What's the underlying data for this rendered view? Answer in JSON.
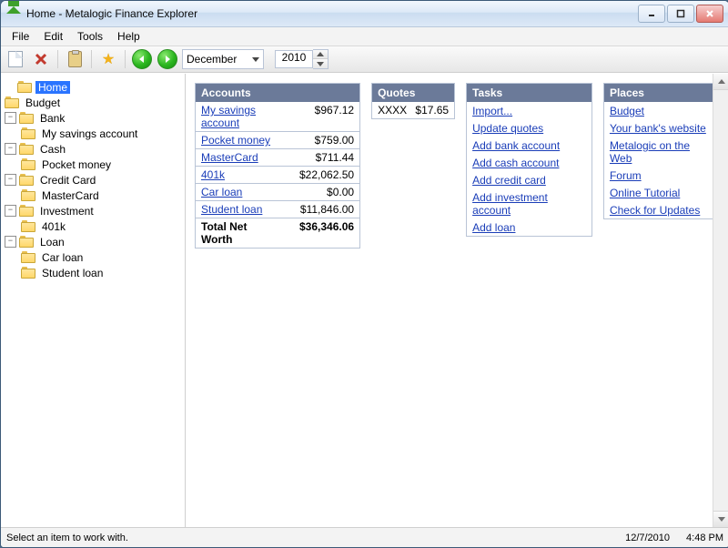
{
  "window": {
    "title": "Home - Metalogic Finance Explorer"
  },
  "menu": {
    "file": "File",
    "edit": "Edit",
    "tools": "Tools",
    "help": "Help"
  },
  "toolbar": {
    "month_selected": "December",
    "year_value": "2010"
  },
  "tree": {
    "home": "Home",
    "budget": "Budget",
    "bank": "Bank",
    "bank_items": {
      "savings": "My savings account"
    },
    "cash": "Cash",
    "cash_items": {
      "pocket": "Pocket money"
    },
    "credit": "Credit Card",
    "credit_items": {
      "mc": "MasterCard"
    },
    "investment": "Investment",
    "investment_items": {
      "k401": "401k"
    },
    "loan": "Loan",
    "loan_items": {
      "car": "Car loan",
      "student": "Student loan"
    }
  },
  "panels": {
    "accounts": {
      "title": "Accounts",
      "rows": [
        {
          "name": "My savings account",
          "value": "$967.12"
        },
        {
          "name": "Pocket money",
          "value": "$759.00"
        },
        {
          "name": "MasterCard",
          "value": "$711.44"
        },
        {
          "name": "401k",
          "value": "$22,062.50"
        },
        {
          "name": "Car loan",
          "value": "$0.00"
        },
        {
          "name": "Student loan",
          "value": "$11,846.00"
        }
      ],
      "total_label": "Total Net Worth",
      "total_value": "$36,346.06"
    },
    "quotes": {
      "title": "Quotes",
      "symbol": "XXXX",
      "price": "$17.65"
    },
    "tasks": {
      "title": "Tasks",
      "items": [
        "Import...",
        "Update quotes",
        "Add bank account",
        "Add cash account",
        "Add credit card",
        "Add investment account",
        "Add loan"
      ]
    },
    "places": {
      "title": "Places",
      "items": [
        "Budget",
        "Your bank's website",
        "Metalogic on the Web",
        "Forum",
        "Online Tutorial",
        "Check for Updates"
      ]
    }
  },
  "status": {
    "hint": "Select an item to work with.",
    "date": "12/7/2010",
    "time": "4:48 PM"
  }
}
